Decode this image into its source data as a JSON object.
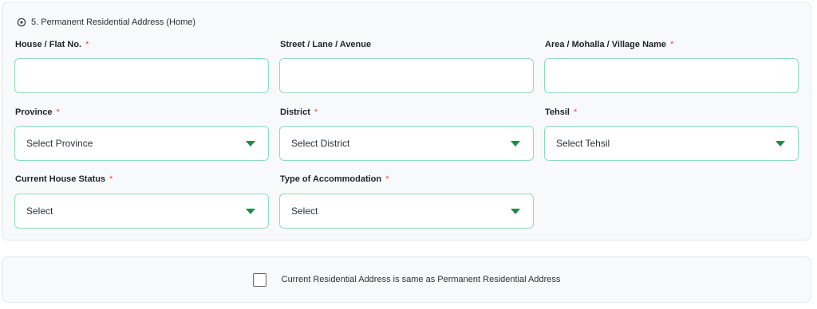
{
  "section": {
    "title": "5. Permanent Residential Address (Home)",
    "icon": "location-pin-icon"
  },
  "required_marker": "*",
  "fields": {
    "house": {
      "label": "House / Flat No.",
      "required": true,
      "value": ""
    },
    "street": {
      "label": "Street / Lane / Avenue",
      "required": false,
      "value": ""
    },
    "area": {
      "label": "Area / Mohalla / Village Name",
      "required": true,
      "value": ""
    },
    "province": {
      "label": "Province",
      "required": true,
      "selected": "Select Province"
    },
    "district": {
      "label": "District",
      "required": true,
      "selected": "Select District"
    },
    "tehsil": {
      "label": "Tehsil",
      "required": true,
      "selected": "Select Tehsil"
    },
    "house_status": {
      "label": "Current House Status",
      "required": true,
      "selected": "Select"
    },
    "accommodation": {
      "label": "Type of Accommodation",
      "required": true,
      "selected": "Select"
    }
  },
  "same_address": {
    "label": "Current Residential Address is same as Permanent Residential Address",
    "checked": false
  },
  "colors": {
    "field_border": "#8fdcbc",
    "caret": "#1f8a4c",
    "required": "#e5484d"
  }
}
